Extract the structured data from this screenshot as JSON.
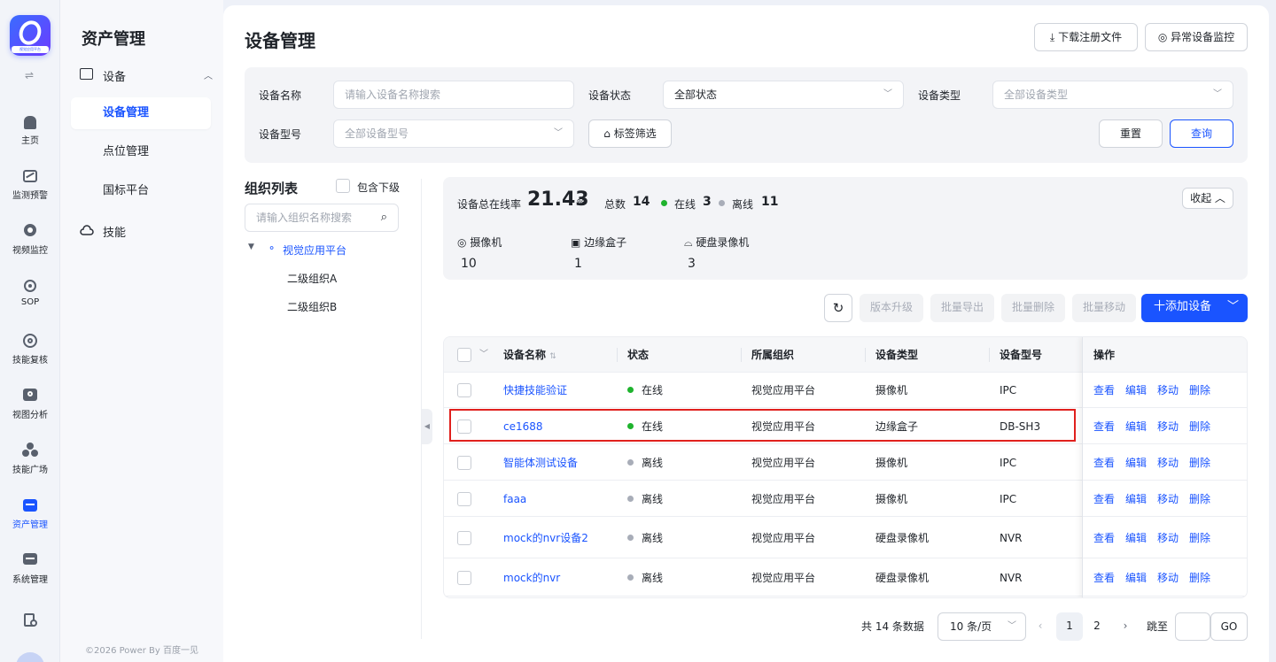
{
  "app": {
    "logo_text": "视觉应用平台"
  },
  "rail": {
    "items": [
      {
        "label": "主页",
        "icon": "home-icon"
      },
      {
        "label": "监测预警",
        "icon": "chart-line-icon"
      },
      {
        "label": "视频监控",
        "icon": "camera-icon"
      },
      {
        "label": "SOP",
        "icon": "sop-icon"
      },
      {
        "label": "技能复核",
        "icon": "hexagon-icon"
      },
      {
        "label": "视图分析",
        "icon": "image-search-icon"
      },
      {
        "label": "技能广场",
        "icon": "cubes-icon"
      },
      {
        "label": "资产管理",
        "icon": "asset-icon",
        "active": true
      },
      {
        "label": "系统管理",
        "icon": "monitor-icon"
      }
    ]
  },
  "panel": {
    "title": "资产管理",
    "group": "设备",
    "items": [
      "设备管理",
      "点位管理",
      "国标平台"
    ],
    "skill": "技能",
    "footer": "©2026 Power By 百度一见"
  },
  "page": {
    "title": "设备管理",
    "download_btn": "下载注册文件",
    "monitor_btn": "异常设备监控"
  },
  "filter": {
    "name_label": "设备名称",
    "name_placeholder": "请输入设备名称搜索",
    "status_label": "设备状态",
    "status_value": "全部状态",
    "type_label": "设备类型",
    "type_placeholder": "全部设备类型",
    "model_label": "设备型号",
    "model_placeholder": "全部设备型号",
    "tag_btn": "标签筛选",
    "reset": "重置",
    "query": "查询"
  },
  "org": {
    "title": "组织列表",
    "include_sub": "包含下级",
    "search_placeholder": "请输入组织名称搜索",
    "root": "视觉应用平台",
    "children": [
      "二级组织A",
      "二级组织B"
    ]
  },
  "stats": {
    "online_rate_label": "设备总在线率",
    "online_rate": "21.43",
    "online_rate_unit": "%",
    "total_label": "总数",
    "total": "14",
    "online_label": "在线",
    "online": "3",
    "offline_label": "离线",
    "offline": "11",
    "collapse": "收起",
    "cats": [
      {
        "label": "摄像机",
        "count": "10"
      },
      {
        "label": "边缘盒子",
        "count": "1"
      },
      {
        "label": "硬盘录像机",
        "count": "3"
      }
    ]
  },
  "toolbar": {
    "upgrade": "版本升级",
    "export": "批量导出",
    "delete": "批量删除",
    "move": "批量移动",
    "add": "十添加设备"
  },
  "table": {
    "headers": [
      "设备名称",
      "状态",
      "所属组织",
      "设备类型",
      "设备型号",
      "操作"
    ],
    "ops": [
      "查看",
      "编辑",
      "移动",
      "删除"
    ],
    "rows": [
      {
        "name": "快捷技能验证",
        "status": "在线",
        "org": "视觉应用平台",
        "type": "摄像机",
        "model": "IPC"
      },
      {
        "name": "ce1688",
        "status": "在线",
        "org": "视觉应用平台",
        "type": "边缘盒子",
        "model": "DB-SH3"
      },
      {
        "name": "智能体测试设备",
        "status": "离线",
        "org": "视觉应用平台",
        "type": "摄像机",
        "model": "IPC"
      },
      {
        "name": "faaa",
        "status": "离线",
        "org": "视觉应用平台",
        "type": "摄像机",
        "model": "IPC"
      },
      {
        "name": "mock的nvr设备2",
        "status": "离线",
        "org": "视觉应用平台",
        "type": "硬盘录像机",
        "model": "NVR"
      },
      {
        "name": "mock的nvr",
        "status": "离线",
        "org": "视觉应用平台",
        "type": "硬盘录像机",
        "model": "NVR"
      }
    ]
  },
  "pagination": {
    "total_text": "共 14 条数据",
    "page_size": "10 条/页",
    "pages": [
      "1",
      "2"
    ],
    "current": "1",
    "jump_label": "跳至",
    "go": "GO"
  },
  "colors": {
    "accent": "#1a54ff",
    "online": "#1fb32e",
    "offline": "#a8adb8",
    "highlight": "#e0201d"
  }
}
